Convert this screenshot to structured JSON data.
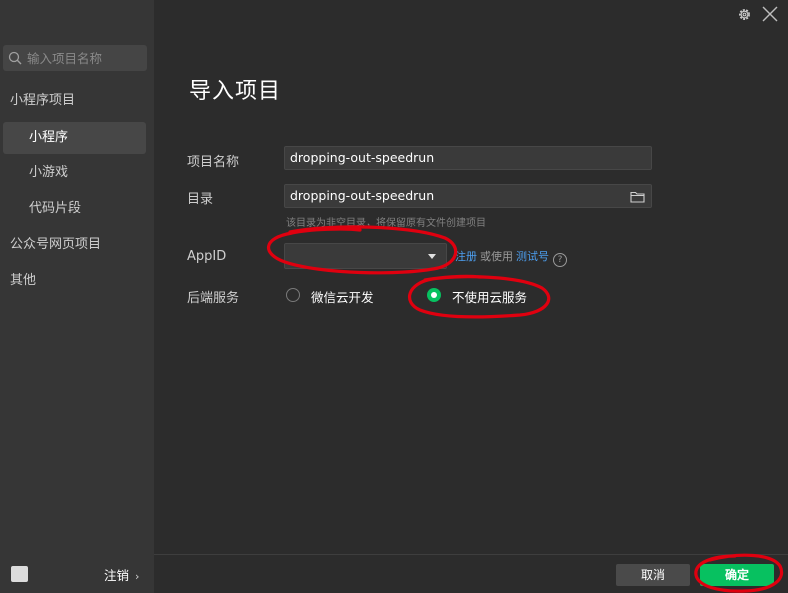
{
  "sidebar": {
    "search_placeholder": "输入项目名称",
    "items": [
      {
        "label": "小程序项目"
      },
      {
        "label": "小程序"
      },
      {
        "label": "小游戏"
      },
      {
        "label": "代码片段"
      },
      {
        "label": "公众号网页项目"
      },
      {
        "label": "其他"
      }
    ],
    "logout_label": "注销",
    "logout_chevron": "›"
  },
  "main": {
    "title": "导入项目",
    "project_name": {
      "label": "项目名称",
      "value": "dropping-out-speedrun"
    },
    "directory": {
      "label": "目录",
      "value": "dropping-out-speedrun",
      "hint": "该目录为非空目录，将保留原有文件创建项目"
    },
    "appid": {
      "label": "AppID",
      "value": "",
      "register_link": "注册",
      "or_use": "或使用",
      "test_link": "测试号",
      "help_glyph": "?"
    },
    "backend": {
      "label": "后端服务",
      "options": [
        {
          "label": "微信云开发",
          "selected": false
        },
        {
          "label": "不使用云服务",
          "selected": true
        }
      ]
    }
  },
  "buttons": {
    "cancel": "取消",
    "confirm": "确定"
  },
  "colors": {
    "accent": "#07c160",
    "link": "#4d9ff0",
    "annotation": "#e0000f"
  }
}
